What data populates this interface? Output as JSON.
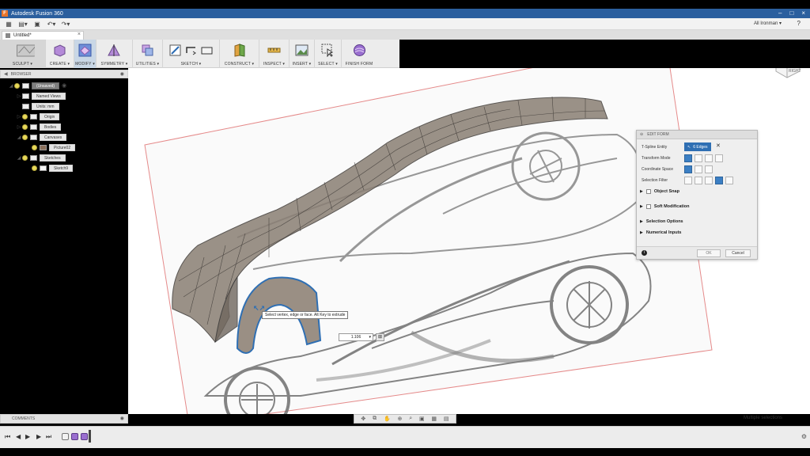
{
  "window": {
    "title": "Autodesk Fusion 360",
    "app_icon": "F"
  },
  "qat": {
    "user": "All Ironman ▾",
    "help": "?"
  },
  "document_tab": {
    "label": "Untitled*",
    "close": "×"
  },
  "toolbar": {
    "groups": [
      {
        "label": "SCULPT ▾"
      },
      {
        "label": "CREATE ▾"
      },
      {
        "label": "MODIFY ▾"
      },
      {
        "label": "SYMMETRY ▾"
      },
      {
        "label": "UTILITIES ▾"
      },
      {
        "label": "SKETCH ▾"
      },
      {
        "label": "CONSTRUCT ▾"
      },
      {
        "label": "INSPECT ▾"
      },
      {
        "label": "INSERT ▾"
      },
      {
        "label": "SELECT ▾"
      },
      {
        "label": "FINISH FORM"
      }
    ]
  },
  "browser": {
    "title": "BROWSER",
    "items": [
      {
        "label": "(Unsaved)"
      },
      {
        "label": "Named Views"
      },
      {
        "label": "Units: mm"
      },
      {
        "label": "Origin"
      },
      {
        "label": "Bodies"
      },
      {
        "label": "Canvases"
      },
      {
        "label": "Picture02"
      },
      {
        "label": "Sketches"
      },
      {
        "label": "Sketch9"
      }
    ]
  },
  "edit_form": {
    "title": "EDIT FORM",
    "tspline_entity_label": "T-Spline Entity",
    "selected_chip": "6 Edges",
    "transform_mode_label": "Transform Mode",
    "coordinate_space_label": "Coordinate Space",
    "selection_filter_label": "Selection Filter",
    "object_snap": "Object Snap",
    "soft_modification": "Soft Modification",
    "selection_options": "Selection Options",
    "numerical_inputs": "Numerical Inputs",
    "ok": "OK",
    "cancel": "Cancel",
    "info": "i"
  },
  "tooltip": {
    "text": "Select vertex, edge or face. Alt Key to extrude"
  },
  "value_input": {
    "value": "1.106"
  },
  "comments": {
    "title": "COMMENTS"
  },
  "status": {
    "text": "Multiple selections"
  },
  "viewcube": {
    "label": "RIGHT"
  },
  "colors": {
    "titlebar": "#2b5f9e",
    "accent_blue": "#2f6fb3",
    "surface": "#8a7f74"
  }
}
